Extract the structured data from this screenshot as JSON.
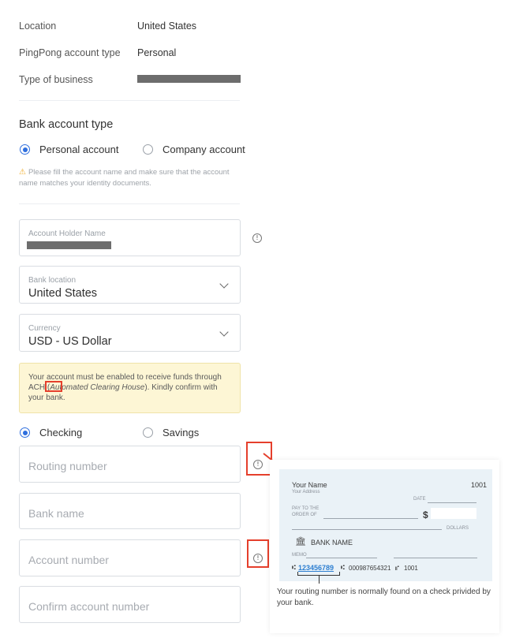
{
  "account_info": {
    "location_label": "Location",
    "location_value": "United States",
    "account_type_label": "PingPong account type",
    "account_type_value": "Personal",
    "business_label": "Type of business"
  },
  "bank_account_type": {
    "title": "Bank account type",
    "options": [
      {
        "label": "Personal account",
        "selected": true
      },
      {
        "label": "Company account",
        "selected": false
      }
    ],
    "warning": "Please fill the account name and make sure that the account name matches your identity documents."
  },
  "fields": {
    "holder_name_label": "Account Holder Name",
    "bank_location_label": "Bank location",
    "bank_location_value": "United States",
    "currency_label": "Currency",
    "currency_value": "USD - US Dollar"
  },
  "notice": {
    "before": "Your account must be enabled to receive funds through ",
    "ach": "ACH",
    "paren_open": " (",
    "italic": "Automated Clearing House",
    "after": "). Kindly confirm with your bank."
  },
  "account_kind": {
    "options": [
      {
        "label": "Checking",
        "selected": true
      },
      {
        "label": "Savings",
        "selected": false
      }
    ]
  },
  "inputs": {
    "routing_placeholder": "Routing number",
    "bank_name_placeholder": "Bank name",
    "account_number_placeholder": "Account number",
    "confirm_account_placeholder": "Confirm account number"
  },
  "check_example": {
    "name": "Your Name",
    "address": "Your Address",
    "number": "1001",
    "date": "DATE",
    "pay_to": "PAY TO THE",
    "order_of": "ORDER OF",
    "dollar_sign": "$",
    "dollars": "DOLLARS",
    "bank_name": "BANK NAME",
    "memo": "MEMO",
    "routing": "123456789",
    "account": "000987654321",
    "check_no": "1001",
    "micr_a": "⑆",
    "micr_b": "⑆",
    "micr_c": "⑈",
    "caption": "Your routing number is normally found on a check privided by your bank."
  },
  "colors": {
    "accent": "#2f6fde",
    "highlight": "#e53f2c",
    "notice_bg": "#fdf6d5",
    "warning": "#f0ad2b"
  }
}
